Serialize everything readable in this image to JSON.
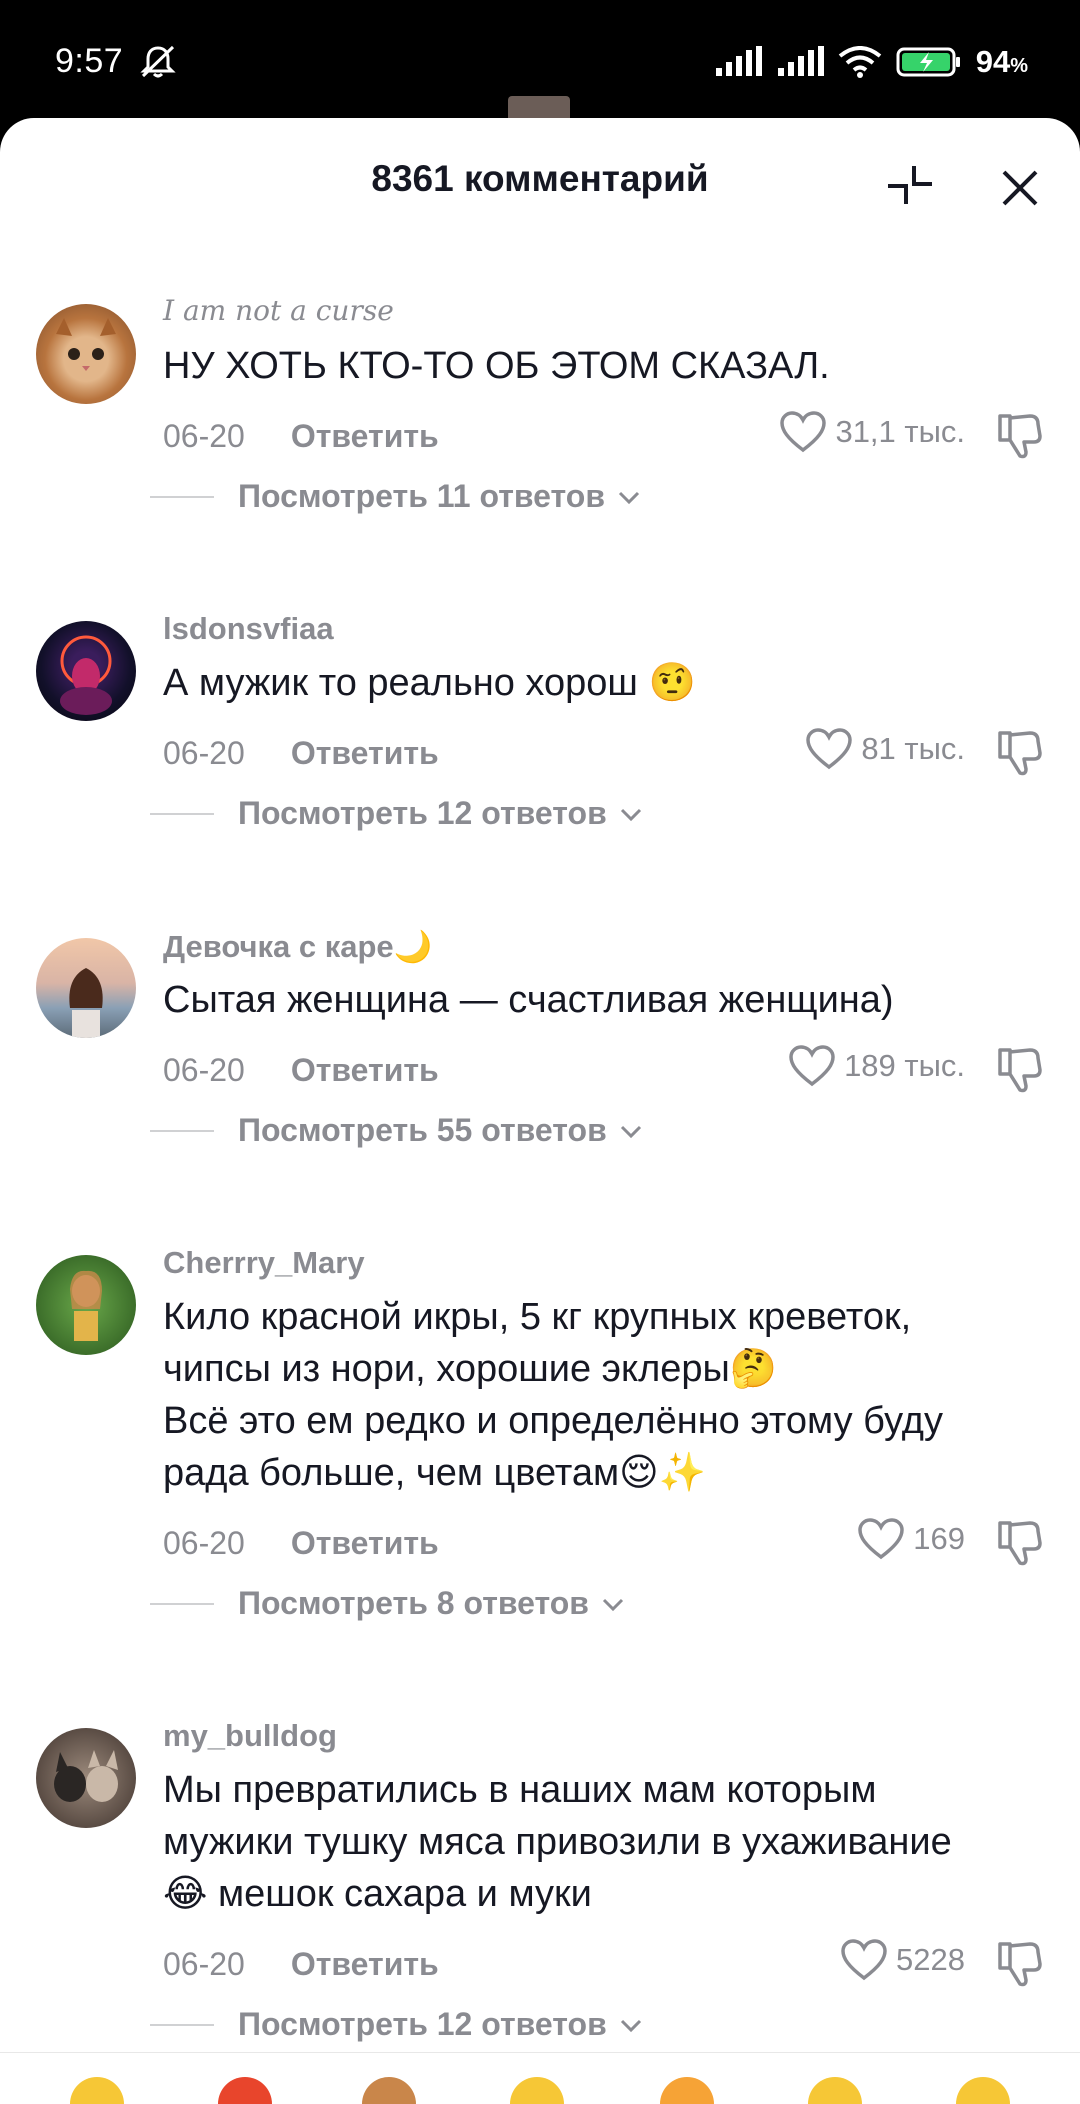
{
  "status_bar": {
    "time": "9:57",
    "battery_percent": "94",
    "battery_unit": "%"
  },
  "sheet": {
    "title": "8361 комментарий"
  },
  "comments": [
    {
      "username": "I am not a curse",
      "text": "НУ ХОТЬ КТО-ТО ОБ ЭТОМ СКАЗАЛ.",
      "date": "06-20",
      "reply_label": "Ответить",
      "likes": "31,1 тыс.",
      "view_replies": "Посмотреть 11 ответов"
    },
    {
      "username": "lsdonsvfiaa",
      "text": "А мужик то реально хорош 🤨",
      "date": "06-20",
      "reply_label": "Ответить",
      "likes": "81 тыс.",
      "view_replies": "Посмотреть 12 ответов"
    },
    {
      "username": "Девочка с каре🌙",
      "text": "Сытая женщина — счастливая женщина)",
      "date": "06-20",
      "reply_label": "Ответить",
      "likes": "189 тыс.",
      "view_replies": "Посмотреть 55 ответов"
    },
    {
      "username": "Cherrry_Mary",
      "text": "Кило красной икры, 5 кг крупных креветок,\nчипсы из нори, хорошие эклеры🤔\nВсё это ем редко и определённо этому буду\nрада больше, чем цветам😌✨",
      "date": "06-20",
      "reply_label": "Ответить",
      "likes": "169",
      "view_replies": "Посмотреть 8 ответов"
    },
    {
      "username": "my_bulldog",
      "text": "Мы превратились в наших мам которым\nмужики тушку мяса привозили в ухаживание\n😂 мешок сахара и муки",
      "date": "06-20",
      "reply_label": "Ответить",
      "likes": "5228",
      "view_replies": "Посмотреть 12 ответов"
    }
  ],
  "colors": {
    "text_primary": "#161823",
    "text_secondary": "#8a8b91",
    "background": "#ffffff"
  }
}
